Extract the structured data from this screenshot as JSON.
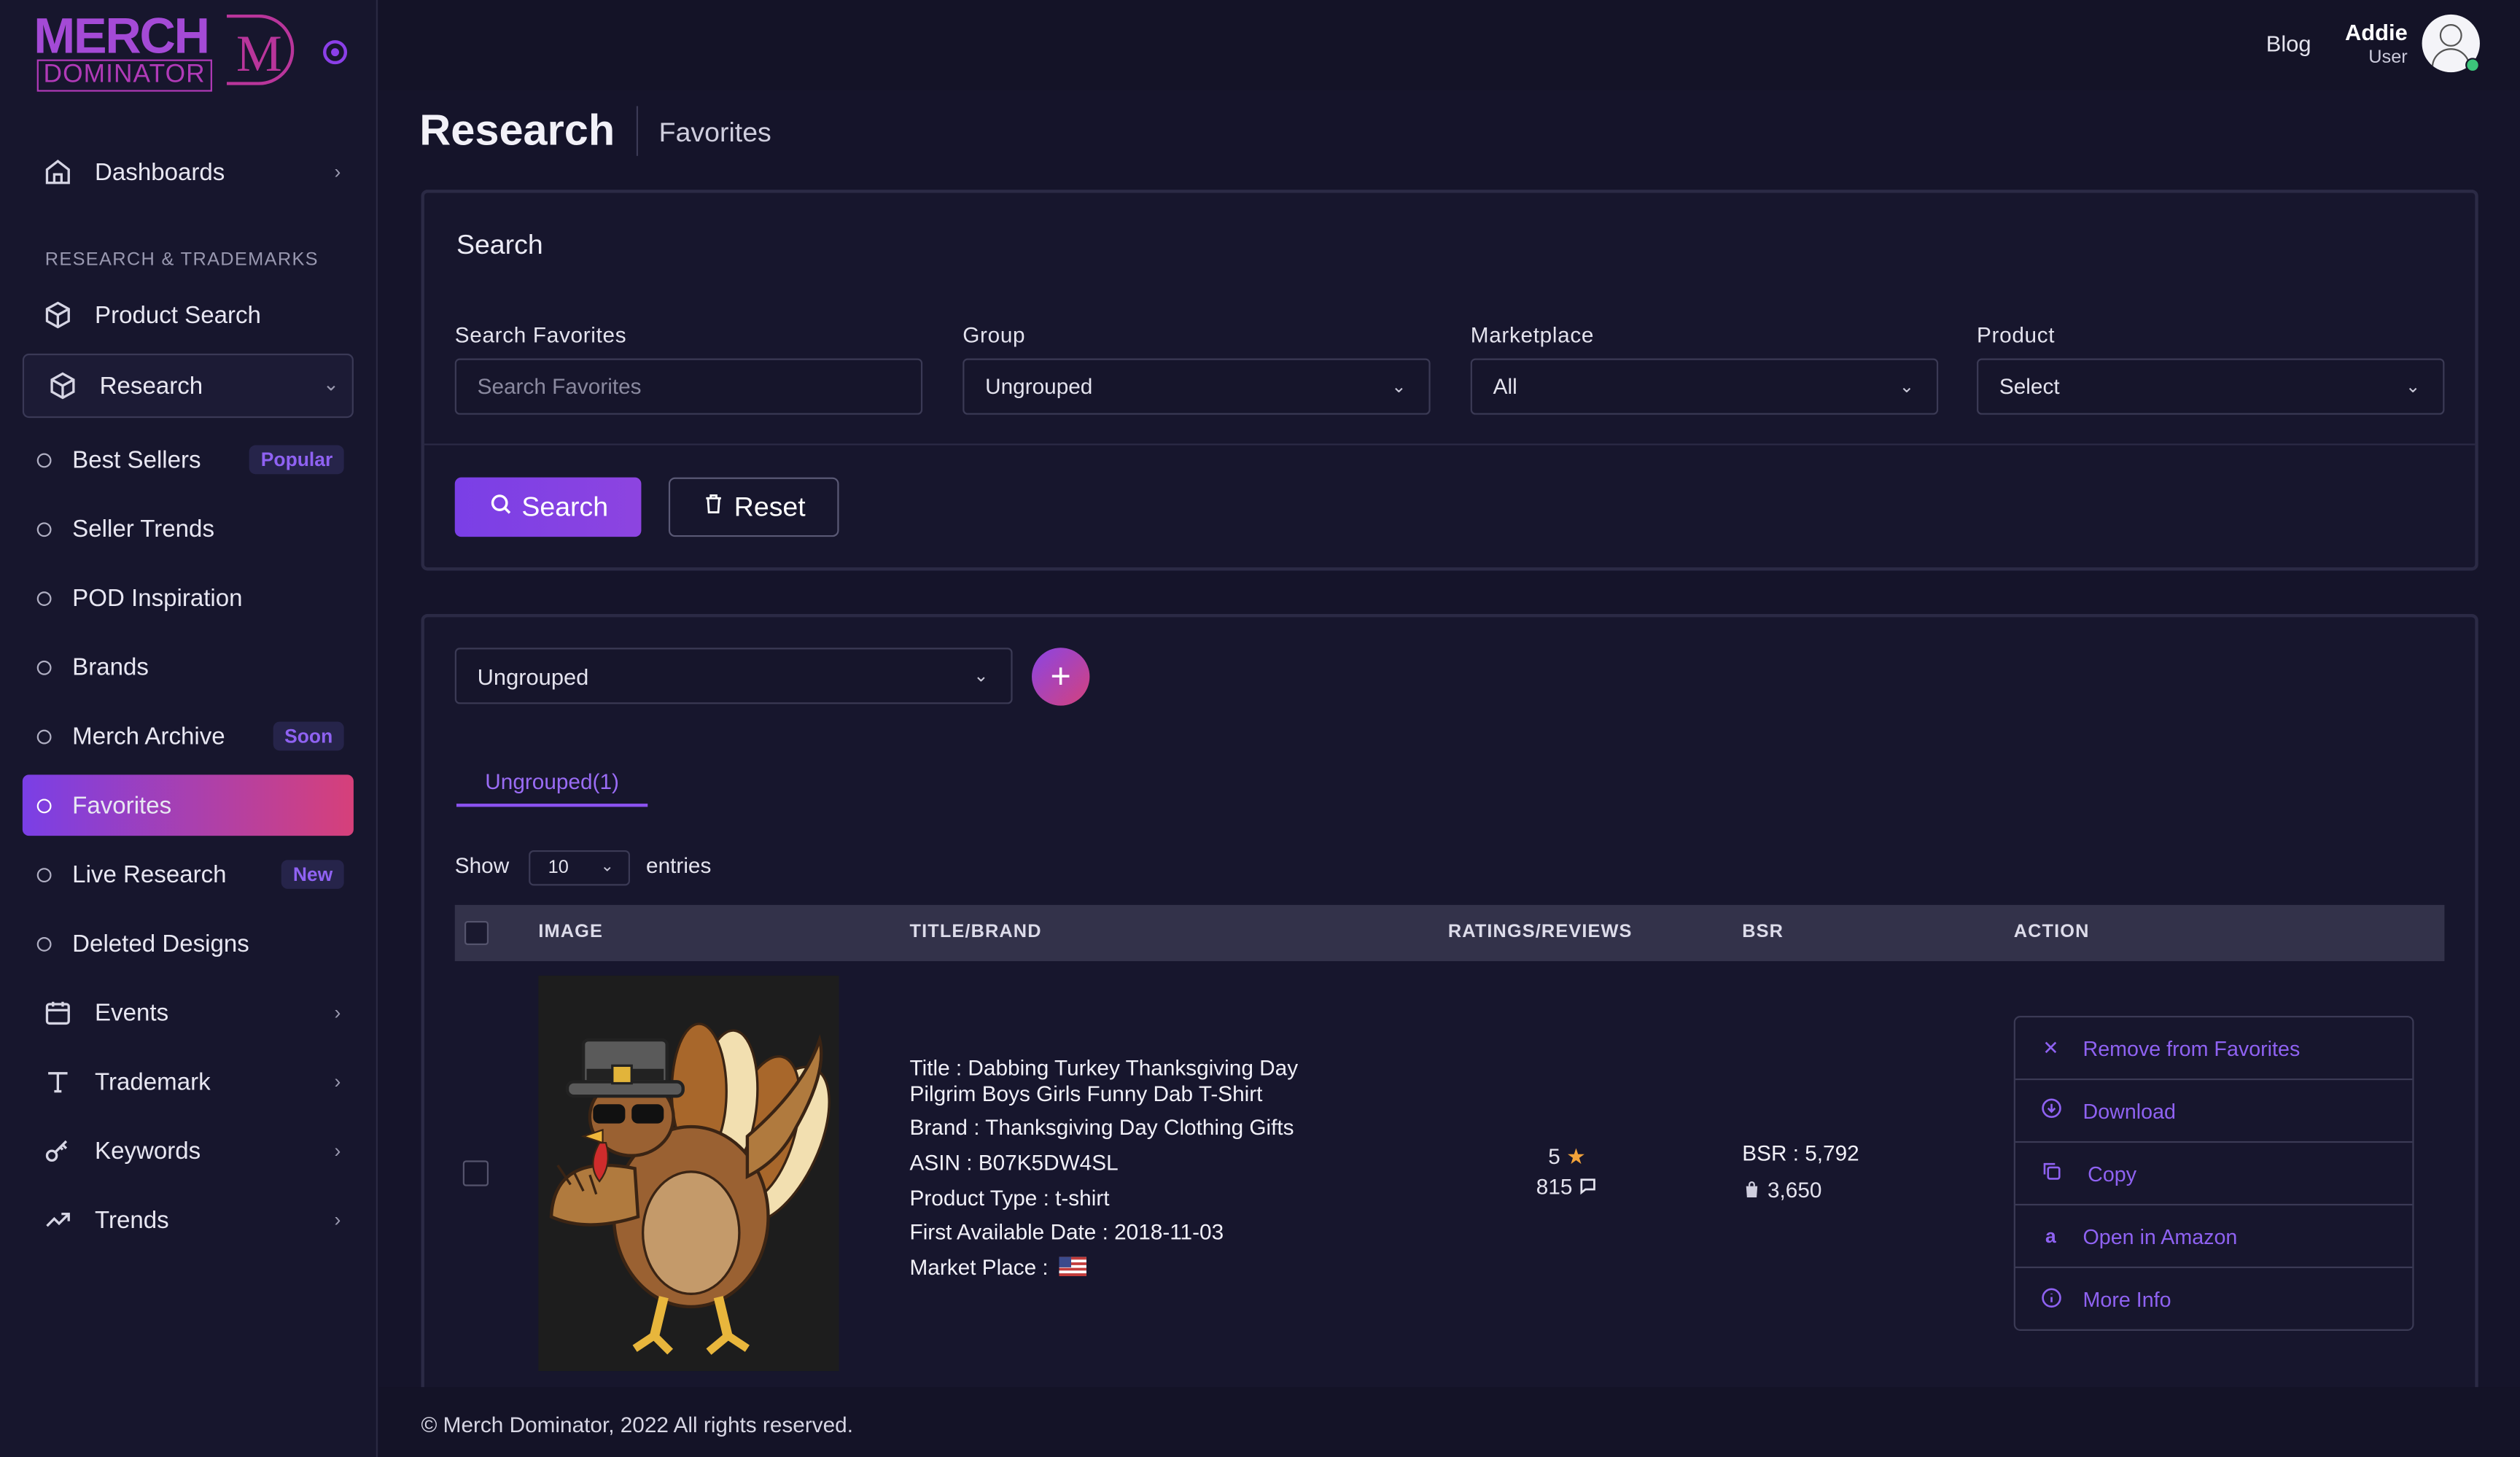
{
  "brand": {
    "line1": "MERCH",
    "line2": "DOMINATOR",
    "mark": "M"
  },
  "sidebar": {
    "dashboards": "Dashboards",
    "section_label": "RESEARCH & TRADEMARKS",
    "product_search": "Product Search",
    "research": "Research",
    "sub_items": [
      {
        "label": "Best Sellers",
        "badge": "Popular"
      },
      {
        "label": "Seller Trends",
        "badge": ""
      },
      {
        "label": "POD Inspiration",
        "badge": ""
      },
      {
        "label": "Brands",
        "badge": ""
      },
      {
        "label": "Merch Archive",
        "badge": "Soon"
      },
      {
        "label": "Favorites",
        "badge": ""
      },
      {
        "label": "Live Research",
        "badge": "New"
      },
      {
        "label": "Deleted Designs",
        "badge": ""
      }
    ],
    "events": "Events",
    "trademark": "Trademark",
    "keywords": "Keywords",
    "trends": "Trends"
  },
  "topbar": {
    "blog": "Blog",
    "user_name": "Addie",
    "user_role": "User"
  },
  "page": {
    "title": "Research",
    "subtitle": "Favorites"
  },
  "search_card": {
    "title": "Search",
    "search_label": "Search Favorites",
    "search_placeholder": "Search Favorites",
    "group_label": "Group",
    "group_value": "Ungrouped",
    "marketplace_label": "Marketplace",
    "marketplace_value": "All",
    "product_label": "Product",
    "product_value": "Select",
    "search_button": "Search",
    "reset_button": "Reset"
  },
  "results": {
    "group_value": "Ungrouped",
    "tab_label": "Ungrouped(1)",
    "show": "Show",
    "entries_value": "10",
    "entries": "entries",
    "columns": [
      "IMAGE",
      "TITLE/BRAND",
      "RATINGS/REVIEWS",
      "BSR",
      "ACTION"
    ],
    "row": {
      "title_line1": "Title : Dabbing Turkey Thanksgiving Day",
      "title_line2": "Pilgrim Boys Girls Funny Dab T-Shirt",
      "brand": "Brand : Thanksgiving Day Clothing Gifts",
      "asin": "ASIN : B07K5DW4SL",
      "product_type": "Product Type : t-shirt",
      "first_available": "First Available Date : 2018-11-03",
      "marketplace": "Market Place :",
      "rating": "5",
      "reviews": "815",
      "bsr": "BSR : 5,792",
      "sales": "3,650"
    },
    "actions": [
      "Remove from Favorites",
      "Download",
      "Copy",
      "Open in Amazon",
      "More Info"
    ]
  },
  "footer": "© Merch Dominator, 2022 All rights reserved.",
  "colors": {
    "accent": "#8b52f0",
    "gradient_end": "#d6407a",
    "bg": "#15142a"
  }
}
